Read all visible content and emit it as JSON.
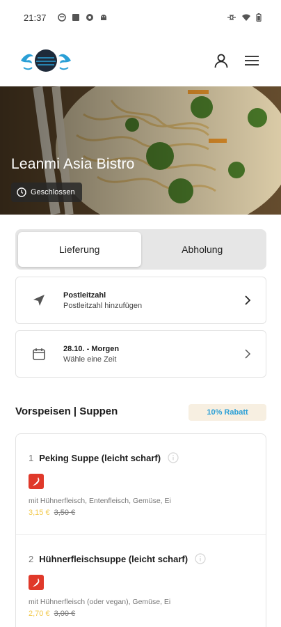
{
  "status_bar": {
    "time": "21:37"
  },
  "hero": {
    "title": "Leanmi Asia Bistro",
    "status": "Geschlossen"
  },
  "order_mode": {
    "options": [
      "Lieferung",
      "Abholung"
    ],
    "selected": "Lieferung"
  },
  "postcode_card": {
    "label": "Postleitzahl",
    "value": "Postleitzahl hinzufügen"
  },
  "time_card": {
    "label": "28.10. - Morgen",
    "value": "Wähle eine Zeit"
  },
  "section": {
    "title": "Vorspeisen | Suppen",
    "badge": "10% Rabatt"
  },
  "items": [
    {
      "number": "1",
      "name": "Peking Suppe (leicht scharf)",
      "description": "mit Hühnerfleisch, Entenfleisch, Gemüse, Ei",
      "price_discounted": "3,15 €",
      "price_original": "3,50 €"
    },
    {
      "number": "2",
      "name": "Hühnerfleischsuppe (leicht scharf)",
      "description": "mit Hühnerfleisch (oder vegan), Gemüse, Ei",
      "price_discounted": "2,70 €",
      "price_original": "3,00 €"
    }
  ],
  "colors": {
    "accent_blue": "#2a9fd6",
    "badge_bg": "#f7efe1",
    "chili_red": "#e0392a",
    "discount_yellow": "#f2c94c"
  }
}
